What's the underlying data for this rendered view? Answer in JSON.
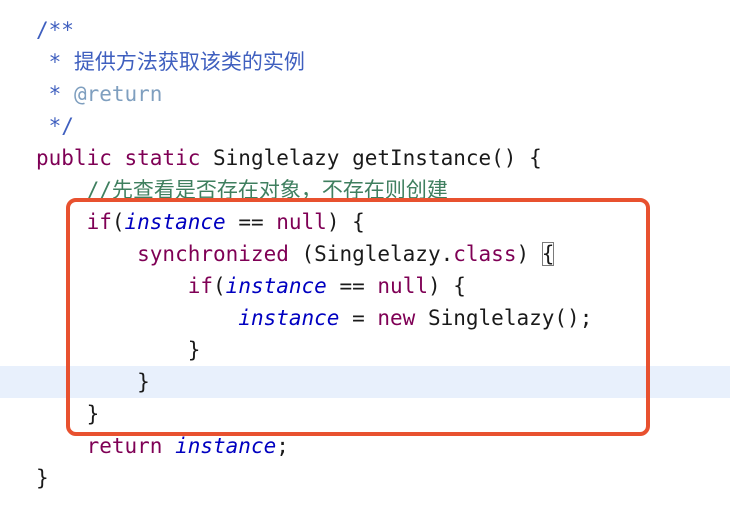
{
  "editor": {
    "current_line_index": 11,
    "highlight_color": "#e8512f",
    "colors": {
      "comment": "#3f5fbf",
      "javadoc_tag": "#7f9fbf",
      "line_comment": "#3f7f5f",
      "keyword": "#7f0055",
      "field": "#0000c0",
      "current_line_bg": "#e8f0fc"
    },
    "lines": [
      {
        "tokens": [
          {
            "t": "/**",
            "c": "comment"
          }
        ]
      },
      {
        "tokens": [
          {
            "t": " * 提供方法获取该类的实例",
            "c": "comment"
          }
        ]
      },
      {
        "tokens": [
          {
            "t": " * ",
            "c": "comment"
          },
          {
            "t": "@return",
            "c": "tag"
          }
        ]
      },
      {
        "tokens": [
          {
            "t": " */",
            "c": "comment"
          }
        ]
      },
      {
        "tokens": [
          {
            "t": "public static",
            "c": "kw"
          },
          {
            "t": " Singlelazy getInstance() {",
            "c": "type"
          }
        ]
      },
      {
        "tokens": [
          {
            "t": "    //先查看是否存在对象，不存在则创建",
            "c": "green"
          }
        ]
      },
      {
        "tokens": [
          {
            "t": "    if",
            "c": "kw"
          },
          {
            "t": "(",
            "c": "type"
          },
          {
            "t": "instance",
            "c": "field"
          },
          {
            "t": " == ",
            "c": "type"
          },
          {
            "t": "null",
            "c": "kw"
          },
          {
            "t": ") {",
            "c": "type"
          }
        ]
      },
      {
        "tokens": [
          {
            "t": "        synchronized",
            "c": "kw"
          },
          {
            "t": " (Singlelazy.",
            "c": "type"
          },
          {
            "t": "class",
            "c": "kw"
          },
          {
            "t": ") ",
            "c": "type"
          },
          {
            "t": "{",
            "c": "type",
            "match": true
          }
        ]
      },
      {
        "tokens": [
          {
            "t": "            if",
            "c": "kw"
          },
          {
            "t": "(",
            "c": "type"
          },
          {
            "t": "instance",
            "c": "field"
          },
          {
            "t": " == ",
            "c": "type"
          },
          {
            "t": "null",
            "c": "kw"
          },
          {
            "t": ") {",
            "c": "type"
          }
        ]
      },
      {
        "tokens": [
          {
            "t": "                ",
            "c": "type"
          },
          {
            "t": "instance",
            "c": "field"
          },
          {
            "t": " = ",
            "c": "type"
          },
          {
            "t": "new",
            "c": "kw"
          },
          {
            "t": " Singlelazy();",
            "c": "type"
          }
        ]
      },
      {
        "tokens": [
          {
            "t": "            }",
            "c": "type"
          }
        ]
      },
      {
        "tokens": [
          {
            "t": "        }",
            "c": "type"
          }
        ]
      },
      {
        "tokens": [
          {
            "t": "    }",
            "c": "type"
          }
        ]
      },
      {
        "tokens": [
          {
            "t": "    return",
            "c": "kw"
          },
          {
            "t": " ",
            "c": "type"
          },
          {
            "t": "instance",
            "c": "field"
          },
          {
            "t": ";",
            "c": "type"
          }
        ]
      },
      {
        "tokens": [
          {
            "t": "}",
            "c": "type"
          }
        ]
      }
    ]
  }
}
